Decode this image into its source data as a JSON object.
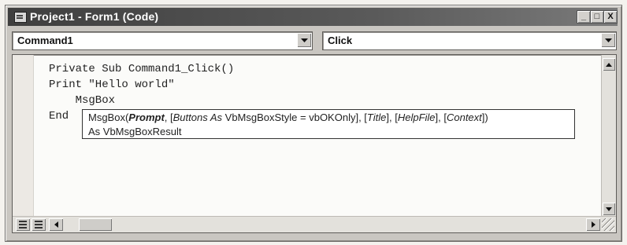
{
  "window": {
    "title": "Project1 - Form1 (Code)",
    "buttons": {
      "minimize": "_",
      "maximize": "□",
      "close": "X"
    }
  },
  "object_combo": {
    "value": "Command1"
  },
  "procedure_combo": {
    "value": "Click"
  },
  "code_lines": [
    "Private Sub Command1_Click()",
    "Print \"Hello world\"",
    "    MsgBox",
    "End"
  ],
  "tooltip": {
    "prefix": "MsgBox(",
    "prompt": "Prompt",
    "sep1": ", [",
    "buttons_param": "Buttons As",
    "buttons_rest": " VbMsgBoxStyle = vbOKOnly], [",
    "title_param": "Title",
    "sep2": "], [",
    "helpfile_param": "HelpFile",
    "sep3": "], [",
    "context_param": "Context",
    "suffix": "])",
    "line2": "As VbMsgBoxResult"
  },
  "icons": [
    "form-icon",
    "minimize-icon",
    "maximize-icon",
    "close-icon",
    "dropdown-arrow-icon",
    "procedure-view-icon",
    "full-module-view-icon",
    "scroll-left-icon",
    "scroll-right-icon",
    "scroll-up-icon",
    "scroll-down-icon",
    "resize-grip-icon"
  ]
}
